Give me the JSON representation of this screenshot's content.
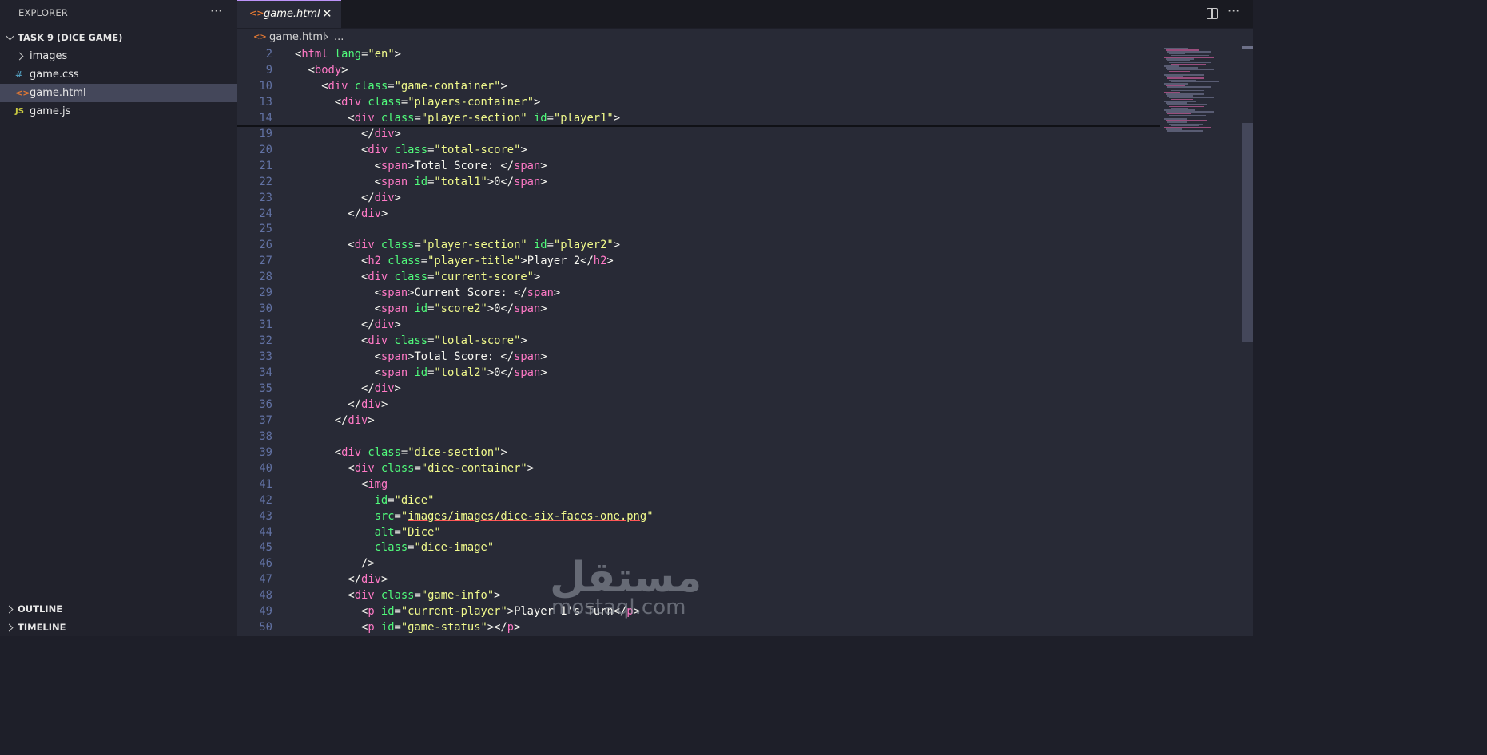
{
  "explorer": {
    "title": "EXPLORER",
    "more": "···",
    "project": "TASK 9 (DICE GAME)",
    "items": [
      {
        "label": "images",
        "icon": "folder-chevron"
      },
      {
        "label": "game.css",
        "icon": "#"
      },
      {
        "label": "game.html",
        "icon": "<>"
      },
      {
        "label": "game.js",
        "icon": "JS"
      }
    ],
    "outline": "OUTLINE",
    "timeline": "TIMELINE"
  },
  "tab": {
    "label": "game.html",
    "icon": "<>",
    "close": "✕"
  },
  "editor_more": "···",
  "breadcrumb": {
    "icon": "<>",
    "file": "game.html",
    "sep": "›",
    "ellipsis": "..."
  },
  "code_lines": [
    {
      "n": "2",
      "ind": 0,
      "tokens": [
        [
          "p",
          "<"
        ],
        [
          "t",
          "html"
        ],
        [
          "a",
          " lang"
        ],
        [
          "p",
          "="
        ],
        [
          "v",
          "\"en\""
        ],
        [
          "p",
          ">"
        ]
      ]
    },
    {
      "n": "9",
      "ind": 1,
      "tokens": [
        [
          "p",
          "<"
        ],
        [
          "t",
          "body"
        ],
        [
          "p",
          ">"
        ]
      ]
    },
    {
      "n": "10",
      "ind": 2,
      "tokens": [
        [
          "p",
          "<"
        ],
        [
          "t",
          "div"
        ],
        [
          "a",
          " class"
        ],
        [
          "p",
          "="
        ],
        [
          "v",
          "\"game-container\""
        ],
        [
          "p",
          ">"
        ]
      ]
    },
    {
      "n": "13",
      "ind": 3,
      "tokens": [
        [
          "p",
          "<"
        ],
        [
          "t",
          "div"
        ],
        [
          "a",
          " class"
        ],
        [
          "p",
          "="
        ],
        [
          "v",
          "\"players-container\""
        ],
        [
          "p",
          ">"
        ]
      ]
    },
    {
      "n": "14",
      "ind": 4,
      "tokens": [
        [
          "p",
          "<"
        ],
        [
          "t",
          "div"
        ],
        [
          "a",
          " class"
        ],
        [
          "p",
          "="
        ],
        [
          "v",
          "\"player-section\""
        ],
        [
          "a",
          " id"
        ],
        [
          "p",
          "="
        ],
        [
          "v",
          "\"player1\""
        ],
        [
          "p",
          ">"
        ]
      ]
    },
    {
      "n": "19",
      "ind": 5,
      "tokens": [
        [
          "p",
          "</"
        ],
        [
          "t",
          "div"
        ],
        [
          "p",
          ">"
        ]
      ]
    },
    {
      "n": "20",
      "ind": 5,
      "tokens": [
        [
          "p",
          "<"
        ],
        [
          "t",
          "div"
        ],
        [
          "a",
          " class"
        ],
        [
          "p",
          "="
        ],
        [
          "v",
          "\"total-score\""
        ],
        [
          "p",
          ">"
        ]
      ]
    },
    {
      "n": "21",
      "ind": 6,
      "tokens": [
        [
          "p",
          "<"
        ],
        [
          "t",
          "span"
        ],
        [
          "p",
          ">Total Score: </"
        ],
        [
          "t",
          "span"
        ],
        [
          "p",
          ">"
        ]
      ]
    },
    {
      "n": "22",
      "ind": 6,
      "tokens": [
        [
          "p",
          "<"
        ],
        [
          "t",
          "span"
        ],
        [
          "a",
          " id"
        ],
        [
          "p",
          "="
        ],
        [
          "v",
          "\"total1\""
        ],
        [
          "p",
          ">0</"
        ],
        [
          "t",
          "span"
        ],
        [
          "p",
          ">"
        ]
      ]
    },
    {
      "n": "23",
      "ind": 5,
      "tokens": [
        [
          "p",
          "</"
        ],
        [
          "t",
          "div"
        ],
        [
          "p",
          ">"
        ]
      ]
    },
    {
      "n": "24",
      "ind": 4,
      "tokens": [
        [
          "p",
          "</"
        ],
        [
          "t",
          "div"
        ],
        [
          "p",
          ">"
        ]
      ]
    },
    {
      "n": "25",
      "ind": 0,
      "tokens": []
    },
    {
      "n": "26",
      "ind": 4,
      "tokens": [
        [
          "p",
          "<"
        ],
        [
          "t",
          "div"
        ],
        [
          "a",
          " class"
        ],
        [
          "p",
          "="
        ],
        [
          "v",
          "\"player-section\""
        ],
        [
          "a",
          " id"
        ],
        [
          "p",
          "="
        ],
        [
          "v",
          "\"player2\""
        ],
        [
          "p",
          ">"
        ]
      ]
    },
    {
      "n": "27",
      "ind": 5,
      "tokens": [
        [
          "p",
          "<"
        ],
        [
          "t",
          "h2"
        ],
        [
          "a",
          " class"
        ],
        [
          "p",
          "="
        ],
        [
          "v",
          "\"player-title\""
        ],
        [
          "p",
          ">Player 2</"
        ],
        [
          "t",
          "h2"
        ],
        [
          "p",
          ">"
        ]
      ]
    },
    {
      "n": "28",
      "ind": 5,
      "tokens": [
        [
          "p",
          "<"
        ],
        [
          "t",
          "div"
        ],
        [
          "a",
          " class"
        ],
        [
          "p",
          "="
        ],
        [
          "v",
          "\"current-score\""
        ],
        [
          "p",
          ">"
        ]
      ]
    },
    {
      "n": "29",
      "ind": 6,
      "tokens": [
        [
          "p",
          "<"
        ],
        [
          "t",
          "span"
        ],
        [
          "p",
          ">Current Score: </"
        ],
        [
          "t",
          "span"
        ],
        [
          "p",
          ">"
        ]
      ]
    },
    {
      "n": "30",
      "ind": 6,
      "tokens": [
        [
          "p",
          "<"
        ],
        [
          "t",
          "span"
        ],
        [
          "a",
          " id"
        ],
        [
          "p",
          "="
        ],
        [
          "v",
          "\"score2\""
        ],
        [
          "p",
          ">0</"
        ],
        [
          "t",
          "span"
        ],
        [
          "p",
          ">"
        ]
      ]
    },
    {
      "n": "31",
      "ind": 5,
      "tokens": [
        [
          "p",
          "</"
        ],
        [
          "t",
          "div"
        ],
        [
          "p",
          ">"
        ]
      ]
    },
    {
      "n": "32",
      "ind": 5,
      "tokens": [
        [
          "p",
          "<"
        ],
        [
          "t",
          "div"
        ],
        [
          "a",
          " class"
        ],
        [
          "p",
          "="
        ],
        [
          "v",
          "\"total-score\""
        ],
        [
          "p",
          ">"
        ]
      ]
    },
    {
      "n": "33",
      "ind": 6,
      "tokens": [
        [
          "p",
          "<"
        ],
        [
          "t",
          "span"
        ],
        [
          "p",
          ">Total Score: </"
        ],
        [
          "t",
          "span"
        ],
        [
          "p",
          ">"
        ]
      ]
    },
    {
      "n": "34",
      "ind": 6,
      "tokens": [
        [
          "p",
          "<"
        ],
        [
          "t",
          "span"
        ],
        [
          "a",
          " id"
        ],
        [
          "p",
          "="
        ],
        [
          "v",
          "\"total2\""
        ],
        [
          "p",
          ">0</"
        ],
        [
          "t",
          "span"
        ],
        [
          "p",
          ">"
        ]
      ]
    },
    {
      "n": "35",
      "ind": 5,
      "tokens": [
        [
          "p",
          "</"
        ],
        [
          "t",
          "div"
        ],
        [
          "p",
          ">"
        ]
      ]
    },
    {
      "n": "36",
      "ind": 4,
      "tokens": [
        [
          "p",
          "</"
        ],
        [
          "t",
          "div"
        ],
        [
          "p",
          ">"
        ]
      ]
    },
    {
      "n": "37",
      "ind": 3,
      "tokens": [
        [
          "p",
          "</"
        ],
        [
          "t",
          "div"
        ],
        [
          "p",
          ">"
        ]
      ]
    },
    {
      "n": "38",
      "ind": 0,
      "tokens": []
    },
    {
      "n": "39",
      "ind": 3,
      "tokens": [
        [
          "p",
          "<"
        ],
        [
          "t",
          "div"
        ],
        [
          "a",
          " class"
        ],
        [
          "p",
          "="
        ],
        [
          "v",
          "\"dice-section\""
        ],
        [
          "p",
          ">"
        ]
      ]
    },
    {
      "n": "40",
      "ind": 4,
      "tokens": [
        [
          "p",
          "<"
        ],
        [
          "t",
          "div"
        ],
        [
          "a",
          " class"
        ],
        [
          "p",
          "="
        ],
        [
          "v",
          "\"dice-container\""
        ],
        [
          "p",
          ">"
        ]
      ]
    },
    {
      "n": "41",
      "ind": 5,
      "tokens": [
        [
          "p",
          "<"
        ],
        [
          "t",
          "img"
        ]
      ]
    },
    {
      "n": "42",
      "ind": 6,
      "tokens": [
        [
          "a",
          "id"
        ],
        [
          "p",
          "="
        ],
        [
          "v",
          "\"dice\""
        ]
      ]
    },
    {
      "n": "43",
      "ind": 6,
      "tokens": [
        [
          "a",
          "src"
        ],
        [
          "p",
          "="
        ],
        [
          "v",
          "\""
        ],
        [
          "l",
          "images/images/dice-six-faces-one.png"
        ],
        [
          "v",
          "\""
        ]
      ]
    },
    {
      "n": "44",
      "ind": 6,
      "tokens": [
        [
          "a",
          "alt"
        ],
        [
          "p",
          "="
        ],
        [
          "v",
          "\"Dice\""
        ]
      ]
    },
    {
      "n": "45",
      "ind": 6,
      "tokens": [
        [
          "a",
          "class"
        ],
        [
          "p",
          "="
        ],
        [
          "v",
          "\"dice-image\""
        ]
      ]
    },
    {
      "n": "46",
      "ind": 5,
      "tokens": [
        [
          "p",
          "/>"
        ]
      ]
    },
    {
      "n": "47",
      "ind": 4,
      "tokens": [
        [
          "p",
          "</"
        ],
        [
          "t",
          "div"
        ],
        [
          "p",
          ">"
        ]
      ]
    },
    {
      "n": "48",
      "ind": 4,
      "tokens": [
        [
          "p",
          "<"
        ],
        [
          "t",
          "div"
        ],
        [
          "a",
          " class"
        ],
        [
          "p",
          "="
        ],
        [
          "v",
          "\"game-info\""
        ],
        [
          "p",
          ">"
        ]
      ]
    },
    {
      "n": "49",
      "ind": 5,
      "tokens": [
        [
          "p",
          "<"
        ],
        [
          "t",
          "p"
        ],
        [
          "a",
          " id"
        ],
        [
          "p",
          "="
        ],
        [
          "v",
          "\"current-player\""
        ],
        [
          "p",
          ">Player 1's Turn</"
        ],
        [
          "t",
          "p"
        ],
        [
          "p",
          ">"
        ]
      ]
    },
    {
      "n": "50",
      "ind": 5,
      "tokens": [
        [
          "p",
          "<"
        ],
        [
          "t",
          "p"
        ],
        [
          "a",
          " id"
        ],
        [
          "p",
          "="
        ],
        [
          "v",
          "\"game-status\""
        ],
        [
          "p",
          "></"
        ],
        [
          "t",
          "p"
        ],
        [
          "p",
          ">"
        ]
      ]
    }
  ],
  "watermark": {
    "logo": "مستقل",
    "site": "mostaql.com"
  },
  "colors": {
    "tag": "#ff79c6",
    "attr": "#50fa7b",
    "value": "#f1fa8c",
    "text": "#f8f8f2",
    "line_number": "#6272a4",
    "editor_bg": "#282a36"
  }
}
